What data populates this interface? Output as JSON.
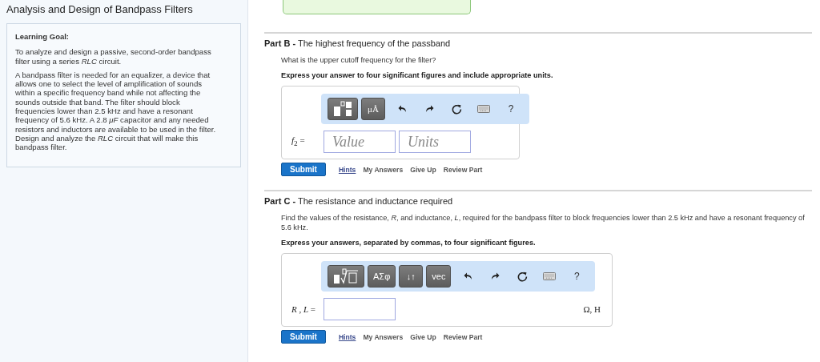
{
  "title": "Analysis and Design of Bandpass Filters",
  "learning_goal": {
    "heading": "Learning Goal:",
    "paragraphs": [
      "To analyze and design a passive, second-order bandpass filter using a series *RLC* circuit.",
      "A bandpass filter is needed for an equalizer, a device that allows one to select the level of amplification of sounds within a specific frequency band while not affecting the sounds outside that band. The filter should block frequencies lower than 2.5 kHz and have a resonant frequency of 5.6 kHz. A 2.8 *μF* capacitor and any needed resistors and inductors are available to be used in the filter. Design and analyze the *RLC* circuit that will make this bandpass filter."
    ]
  },
  "parts": [
    {
      "heading": "**Part B -** The highest frequency of the passband",
      "question": "What is the upper cutoff frequency for the filter?",
      "instruction": "Express your answer to four significant figures and include appropriate units.",
      "toolbar": [
        {
          "kind": "fraction"
        },
        {
          "kind": "text",
          "label": "μÅ"
        },
        {
          "kind": "undo"
        },
        {
          "kind": "redo"
        },
        {
          "kind": "reset"
        },
        {
          "kind": "keyboard"
        },
        {
          "kind": "help",
          "label": "?"
        }
      ],
      "answer_label": "*f*$_{2}$ =",
      "fields": [
        {
          "kind": "hint",
          "placeholder": "Value"
        },
        {
          "kind": "hint",
          "placeholder": "Units"
        }
      ],
      "submit": "Submit",
      "links": [
        "Hints",
        "My Answers",
        "Give Up",
        "Review Part"
      ]
    },
    {
      "heading": "**Part C -** The resistance and inductance required",
      "question": "Find the values of the resistance, *R*, and inductance, *L*, required for the bandpass filter to block frequencies lower than 2.5 kHz and have a resonant frequency of 5.6 kHz.",
      "instruction": "Express your answers, separated by commas, to four significant figures.",
      "toolbar": [
        {
          "kind": "radical"
        },
        {
          "kind": "text",
          "label": "ΑΣφ"
        },
        {
          "kind": "text",
          "label": "↓↑"
        },
        {
          "kind": "text",
          "label": "vec"
        },
        {
          "kind": "undo"
        },
        {
          "kind": "redo"
        },
        {
          "kind": "reset"
        },
        {
          "kind": "keyboard"
        },
        {
          "kind": "help",
          "label": "?"
        }
      ],
      "answer_label": "*R* , *L* =",
      "fields": [
        {
          "kind": "blank"
        }
      ],
      "units": "Ω, H",
      "submit": "Submit",
      "links": [
        "Hints",
        "My Answers",
        "Give Up",
        "Review Part"
      ]
    }
  ]
}
